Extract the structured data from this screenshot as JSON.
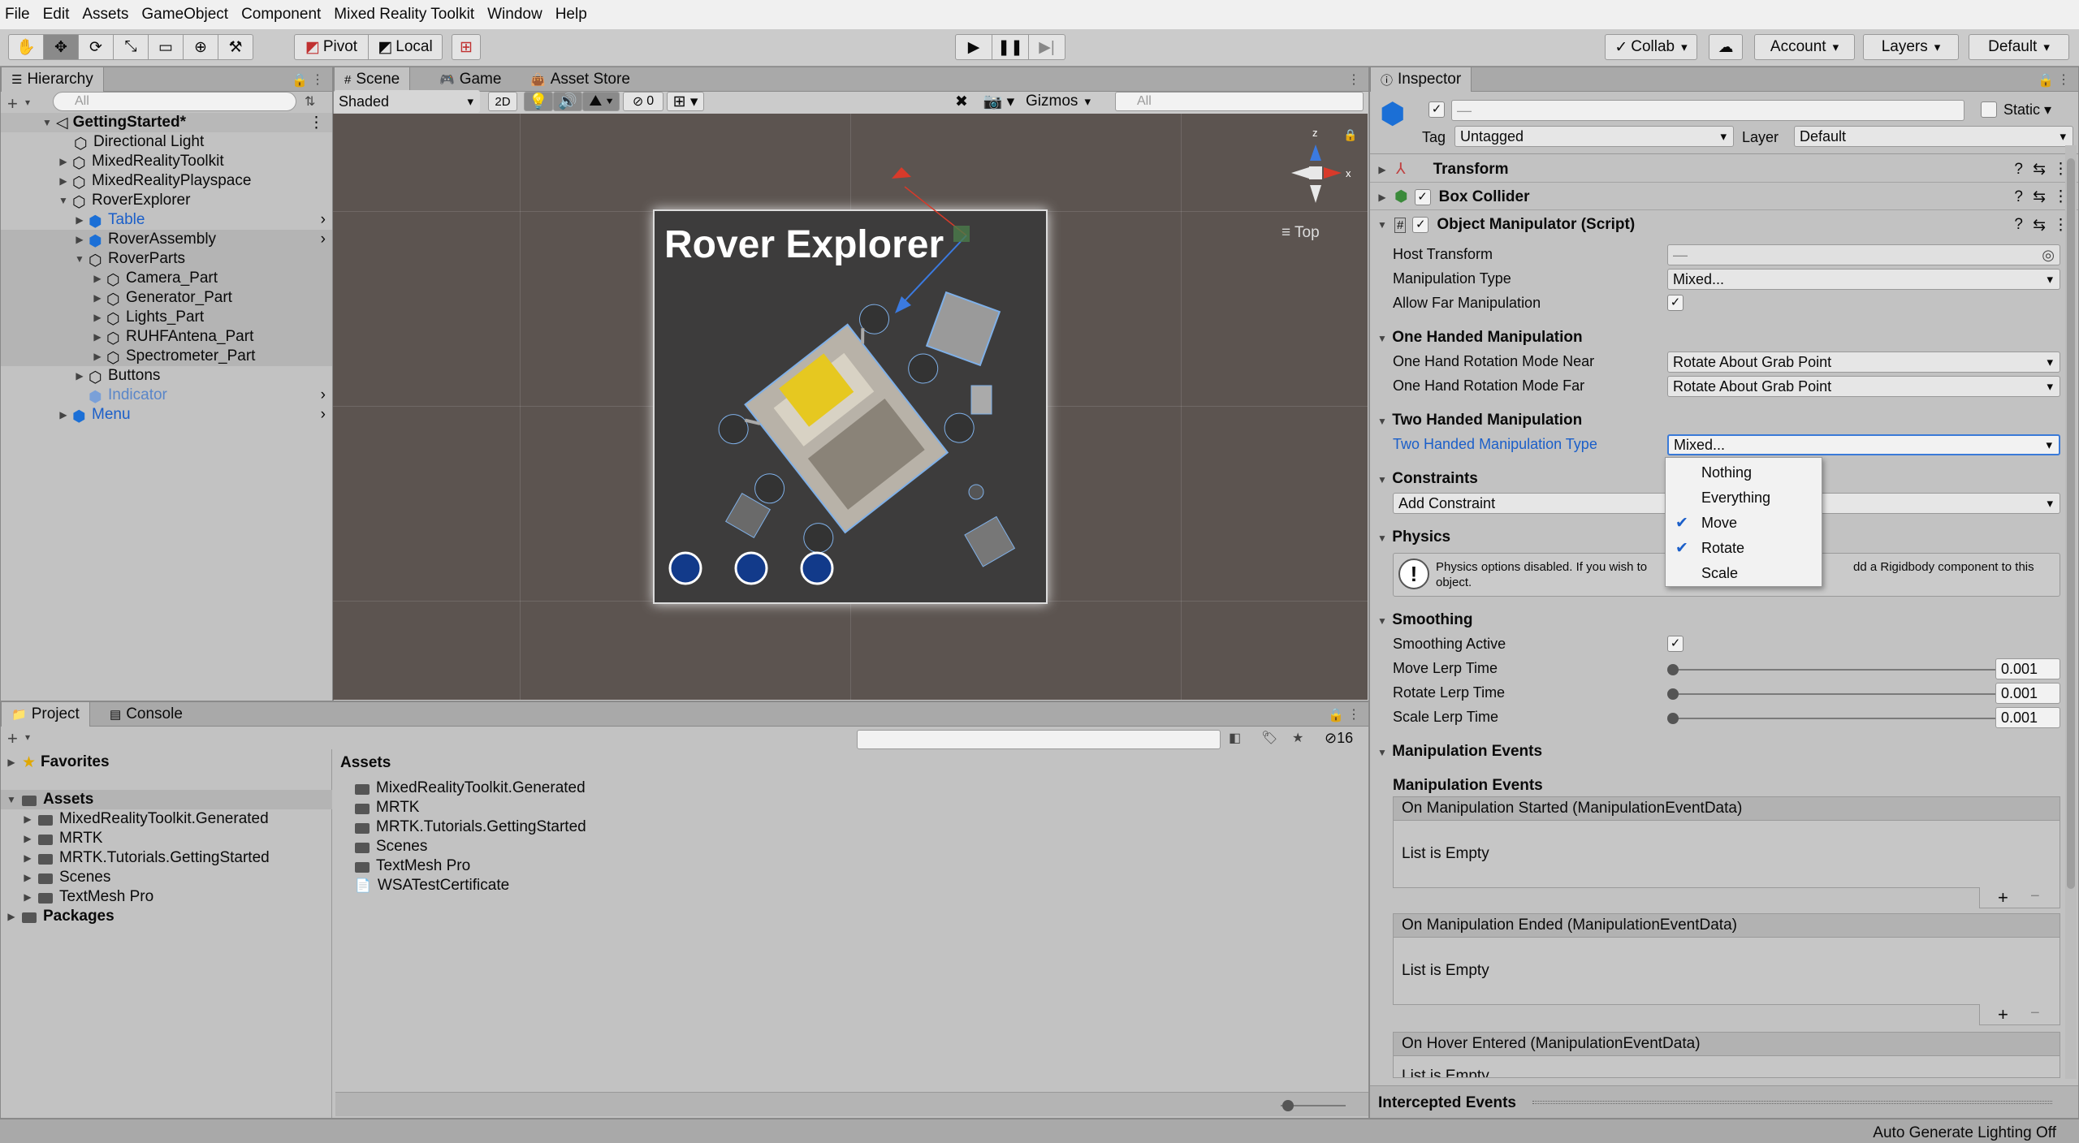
{
  "menu": [
    "File",
    "Edit",
    "Assets",
    "GameObject",
    "Component",
    "Mixed Reality Toolkit",
    "Window",
    "Help"
  ],
  "toolbar": {
    "pivot": "Pivot",
    "local": "Local",
    "collab": "Collab",
    "account": "Account",
    "layers": "Layers",
    "layout": "Default"
  },
  "hierarchy": {
    "tab": "Hierarchy",
    "search_placeholder": "All",
    "scene": "GettingStarted*",
    "items": [
      {
        "label": "Directional Light"
      },
      {
        "label": "MixedRealityToolkit"
      },
      {
        "label": "MixedRealityPlayspace"
      },
      {
        "label": "RoverExplorer"
      },
      {
        "label": "Table"
      },
      {
        "label": "RoverAssembly"
      },
      {
        "label": "RoverParts"
      },
      {
        "label": "Camera_Part"
      },
      {
        "label": "Generator_Part"
      },
      {
        "label": "Lights_Part"
      },
      {
        "label": "RUHFAntena_Part"
      },
      {
        "label": "Spectrometer_Part"
      },
      {
        "label": "Buttons"
      },
      {
        "label": "Indicator"
      },
      {
        "label": "Menu"
      }
    ]
  },
  "scene": {
    "tabs": [
      "Scene",
      "Game",
      "Asset Store"
    ],
    "shading": "Shaded",
    "mode2d": "2D",
    "hidden_count": "0",
    "gizmos": "Gizmos",
    "search_placeholder": "All",
    "view_label": "Top",
    "content_title": "Rover Explorer",
    "axis_x": "x",
    "axis_z": "z"
  },
  "project": {
    "tabs": [
      "Project",
      "Console"
    ],
    "hidden_count": "16",
    "favorites": "Favorites",
    "assets": "Assets",
    "tree": [
      "MixedRealityToolkit.Generated",
      "MRTK",
      "MRTK.Tutorials.GettingStarted",
      "Scenes",
      "TextMesh Pro"
    ],
    "packages": "Packages",
    "header": "Assets",
    "files": [
      "MixedRealityToolkit.Generated",
      "MRTK",
      "MRTK.Tutorials.GettingStarted",
      "Scenes",
      "TextMesh Pro",
      "WSATestCertificate"
    ]
  },
  "inspector": {
    "tab": "Inspector",
    "name_value": "—",
    "static": "Static",
    "tag_label": "Tag",
    "tag_value": "Untagged",
    "layer_label": "Layer",
    "layer_value": "Default",
    "components": [
      "Transform",
      "Box Collider",
      "Object Manipulator (Script)"
    ],
    "fields": {
      "host_transform": "Host Transform",
      "host_transform_value": "—",
      "manipulation_type": "Manipulation Type",
      "manipulation_type_value": "Mixed...",
      "allow_far": "Allow Far Manipulation",
      "one_handed": "One Handed Manipulation",
      "near_mode": "One Hand Rotation Mode Near",
      "near_mode_value": "Rotate About Grab Point",
      "far_mode": "One Hand Rotation Mode Far",
      "far_mode_value": "Rotate About Grab Point",
      "two_handed": "Two Handed Manipulation",
      "two_type": "Two Handed Manipulation Type",
      "two_type_value": "Mixed...",
      "constraints": "Constraints",
      "add_constraint": "Add Constraint",
      "physics": "Physics",
      "physics_note": "Physics options disabled. If you wish to",
      "physics_note_end": "dd a Rigidbody component to this",
      "physics_note_last": "object.",
      "smoothing": "Smoothing",
      "smoothing_active": "Smoothing Active",
      "move_lerp": "Move Lerp Time",
      "move_lerp_value": "0.001",
      "rotate_lerp": "Rotate Lerp Time",
      "rotate_lerp_value": "0.001",
      "scale_lerp": "Scale Lerp Time",
      "scale_lerp_value": "0.001",
      "manip_events": "Manipulation Events",
      "manip_events_sub": "Manipulation Events",
      "ev1": "On Manipulation Started (ManipulationEventData)",
      "ev2": "On Manipulation Ended (ManipulationEventData)",
      "ev3": "On Hover Entered (ManipulationEventData)",
      "empty": "List is Empty",
      "empty_partial": "List is Empty",
      "intercepted": "Intercepted Events"
    },
    "popup": [
      {
        "label": "Nothing",
        "checked": false
      },
      {
        "label": "Everything",
        "checked": false
      },
      {
        "label": "Move",
        "checked": true
      },
      {
        "label": "Rotate",
        "checked": true
      },
      {
        "label": "Scale",
        "checked": false
      }
    ]
  },
  "status": "Auto Generate Lighting Off"
}
